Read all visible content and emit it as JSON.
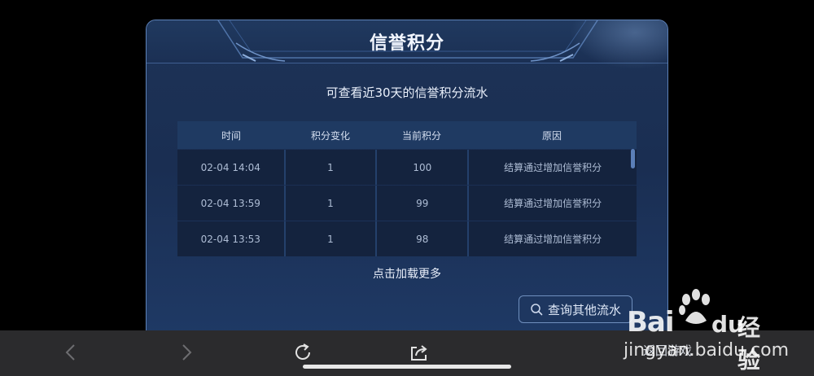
{
  "dialog": {
    "title": "信誉积分",
    "subtitle": "可查看近30天的信誉积分流水",
    "table": {
      "headers": [
        "时间",
        "积分变化",
        "当前积分",
        "原因"
      ],
      "rows": [
        [
          "02-04  14:04",
          "1",
          "100",
          "结算通过增加信誉积分"
        ],
        [
          "02-04  13:59",
          "1",
          "99",
          "结算通过增加信誉积分"
        ],
        [
          "02-04  13:53",
          "1",
          "98",
          "结算通过增加信誉积分"
        ]
      ]
    },
    "load_more_label": "点击加载更多",
    "query_button_label": "查询其他流水"
  },
  "bottom_bar": {
    "return_label": "返回游戏"
  },
  "watermark": {
    "brand_left": "Bai",
    "brand_right": "du",
    "product": "经验",
    "url": "jingyan.baidu.com"
  },
  "colors": {
    "panel_bg": "#1a2e52",
    "panel_border": "#5e82b8",
    "table_header_bg": "#1f3a62",
    "table_row_bg": "#14233e",
    "bottom_bar_bg": "#2b2b2d"
  },
  "icons": [
    "search-icon",
    "back-icon",
    "forward-icon",
    "reload-icon",
    "share-icon",
    "paw-icon"
  ]
}
